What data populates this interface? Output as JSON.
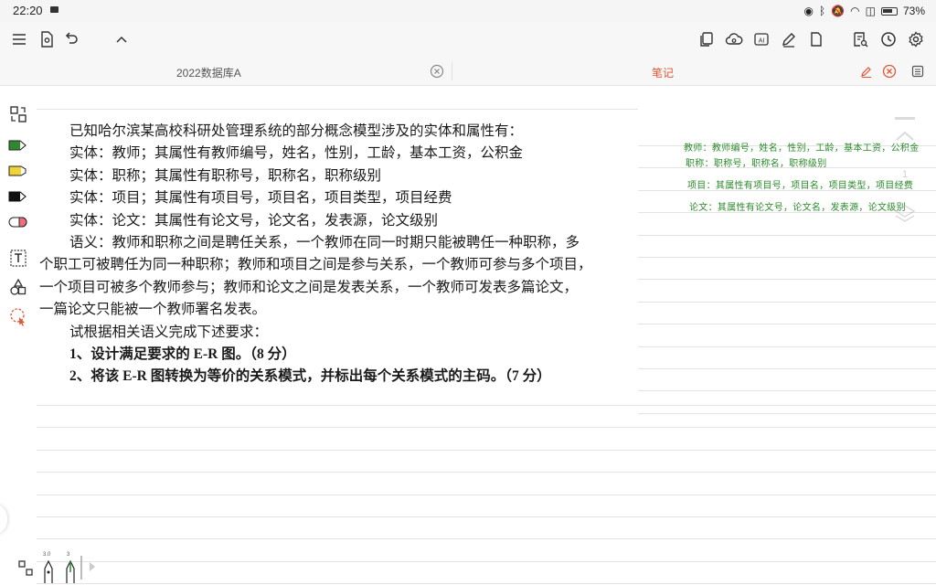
{
  "status_bar": {
    "time": "22:20",
    "battery": "73%"
  },
  "tabs": {
    "document": "2022数据库A",
    "notes": "笔记"
  },
  "document": {
    "lines": [
      "已知哈尔滨某高校科研处管理系统的部分概念模型涉及的实体和属性有：",
      "实体：教师；其属性有教师编号，姓名，性别，工龄，基本工资，公积金",
      "实体：职称；其属性有职称号，职称名，职称级别",
      "实体：项目；其属性有项目号，项目名，项目类型，项目经费",
      "实体：论文：其属性有论文号，论文名，发表源，论文级别",
      "语义：教师和职称之间是聘任关系，一个教师在同一时期只能被聘任一种职称，多",
      "个职工可被聘任为同一种职称；教师和项目之间是参与关系，一个教师可参与多个项目，",
      "一个项目可被多个教师参与；教师和论文之间是发表关系，一个教师可发表多篇论文，",
      "一篇论文只能被一个教师署名发表。",
      "试根据相关语义完成下述要求：",
      "1、设计满足要求的 E-R 图。（8 分）",
      "2、将该 E-R 图转换为等价的关系模式，并标出每个关系模式的主码。（7 分）"
    ]
  },
  "notes": [
    "教师：教师编号，姓名，性别，工龄，基本工资，公积金",
    "职称：职称号，职称名，职称级别",
    "项目：其属性有项目号，项目名，项目类型，项目经费",
    "论文：其属性有论文号，论文名，发表源，论文级别"
  ],
  "page_nav": {
    "current": "1"
  },
  "pen_sizes": {
    "pen1": "3.0",
    "pen2": "3"
  },
  "colors": {
    "accent": "#e05535",
    "note_ink": "#2a8a2a",
    "rule": "#e3e3e3"
  },
  "icons": {
    "toolbar_left": [
      "menu-icon",
      "eye-doc-icon",
      "undo-icon",
      "chevron-up-icon"
    ],
    "toolbar_right": [
      "copy-icon",
      "cloud-sync-icon",
      "ai-icon",
      "pen-edit-icon",
      "page-icon",
      "search-doc-icon",
      "clock-icon",
      "settings-icon"
    ],
    "left_tools": [
      "swap-icon",
      "green-pen-icon",
      "highlighter-icon",
      "black-pen-icon",
      "eraser-icon",
      "text-tool-icon",
      "shapes-icon",
      "lasso-icon"
    ]
  }
}
